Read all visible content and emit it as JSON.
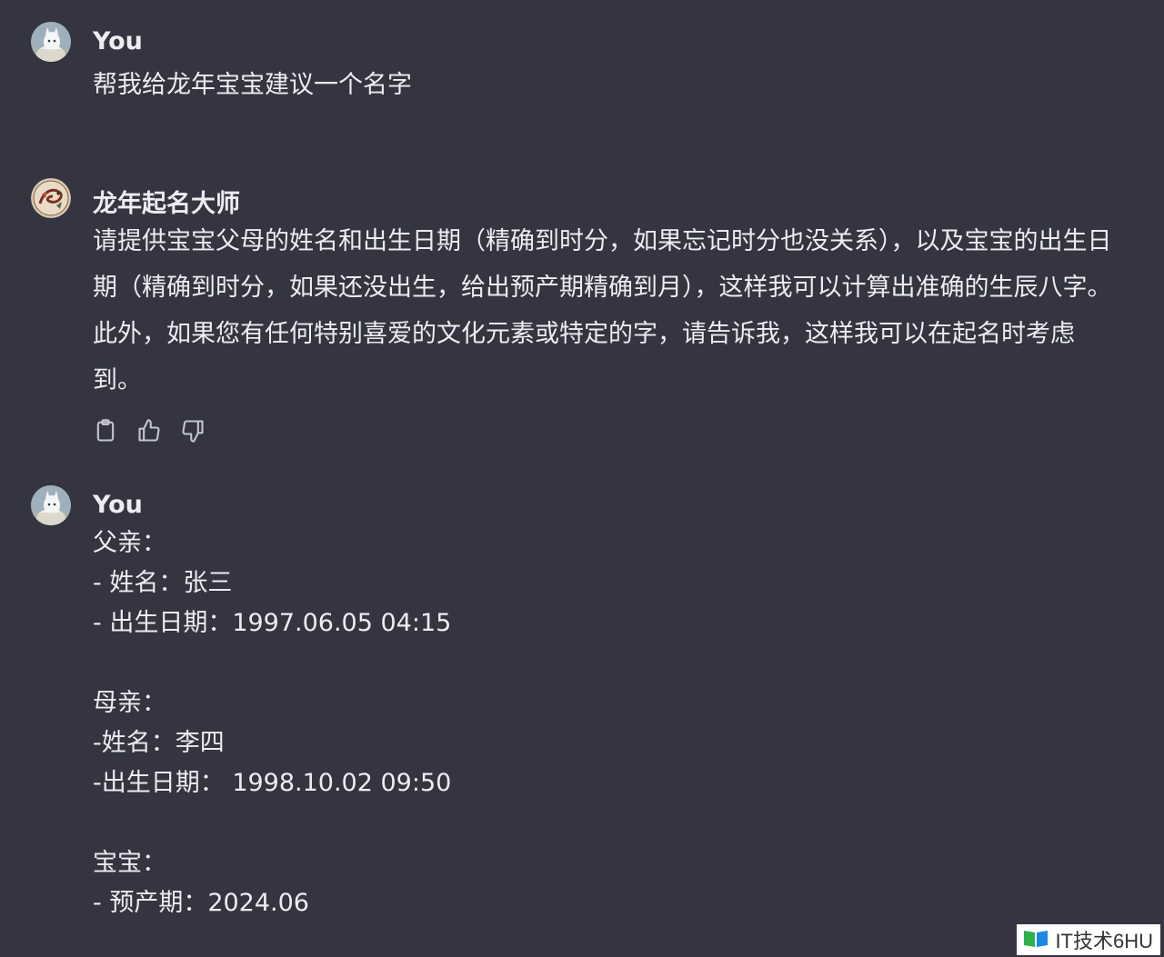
{
  "conversation": {
    "messages": [
      {
        "author": "You",
        "avatar_icon": "user-avatar-icon",
        "text": "帮我给龙年宝宝建议一个名字"
      },
      {
        "author": "龙年起名大师",
        "avatar_icon": "dragon-avatar-icon",
        "text": "请提供宝宝父母的姓名和出生日期（精确到时分，如果忘记时分也没关系），以及宝宝的出生日期（精确到时分，如果还没出生，给出预产期精确到月），这样我可以计算出准确的生辰八字。此外，如果您有任何特别喜爱的文化元素或特定的字，请告诉我，这样我可以在起名时考虑到。",
        "actions": [
          "copy-icon",
          "thumbs-up-icon",
          "thumbs-down-icon"
        ]
      },
      {
        "author": "You",
        "avatar_icon": "user-avatar-icon",
        "text": "父亲：\n- 姓名：张三\n- 出生日期：1997.06.05 04:15\n\n母亲：\n-姓名：李四\n-出生日期： 1998.10.02 09:50\n\n宝宝：\n- 预产期：2024.06"
      }
    ]
  },
  "watermark": {
    "text": "IT技术6HU",
    "icon": "book-icon"
  },
  "colors": {
    "background": "#343541",
    "text": "#ececf1",
    "icon": "#c5c5d2"
  }
}
